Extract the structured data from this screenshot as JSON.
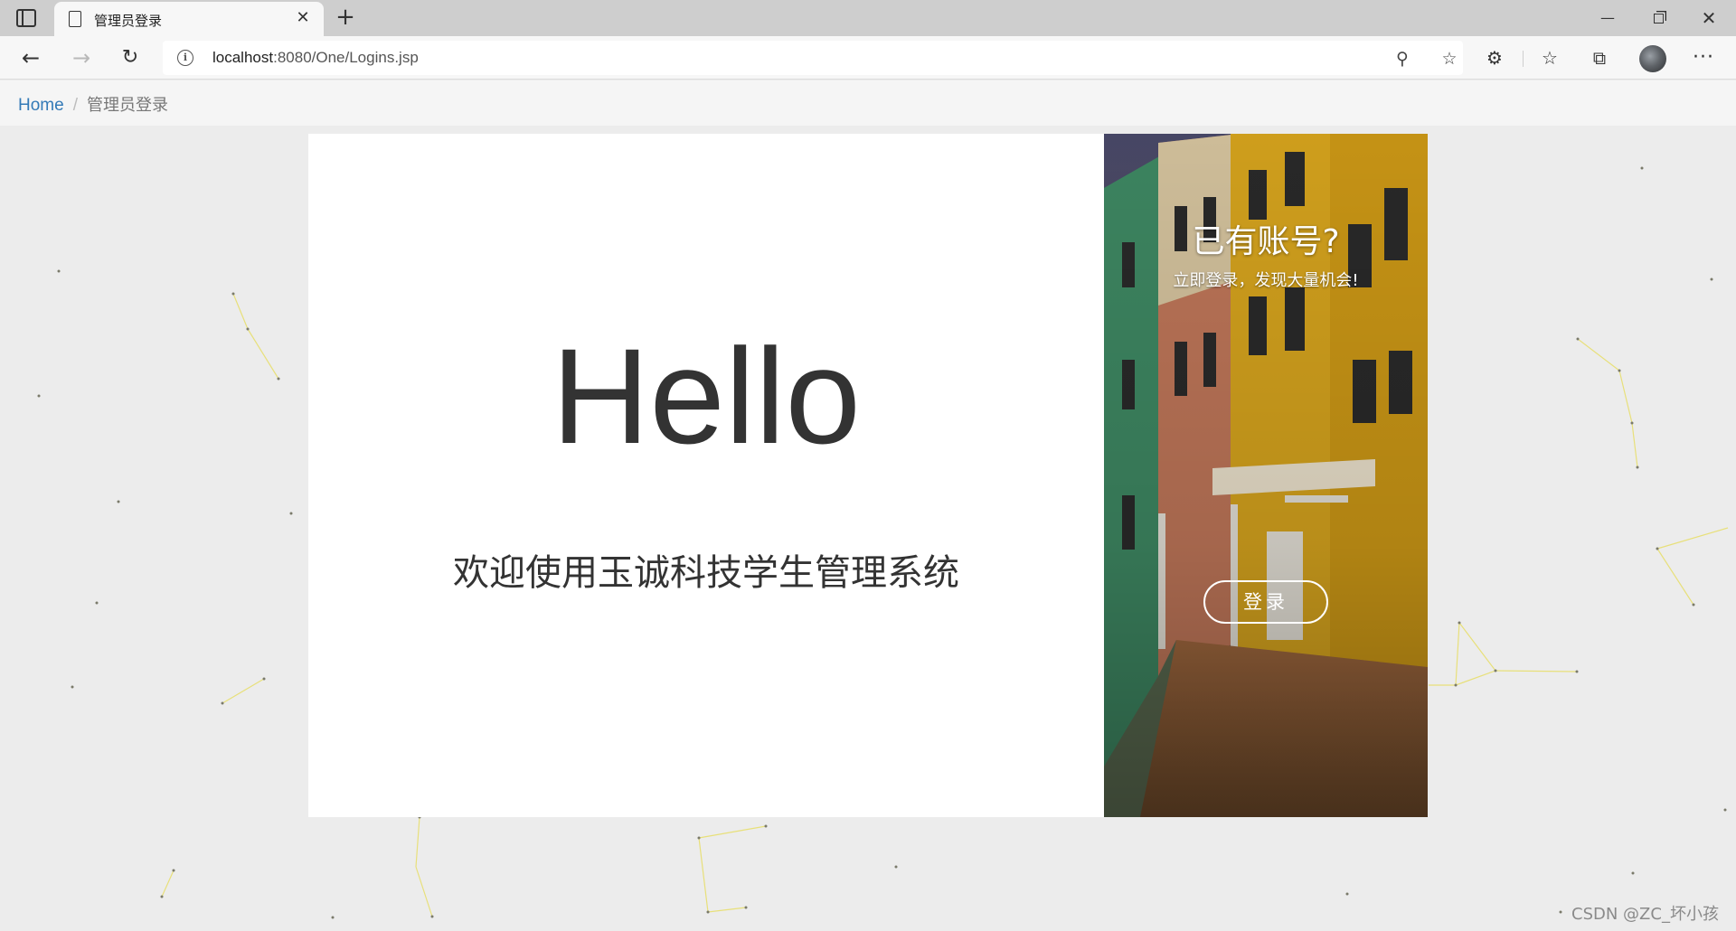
{
  "browser": {
    "tab_title": "管理员登录",
    "url_host": "localhost",
    "url_rest": ":8080/One/Logins.jsp"
  },
  "breadcrumb": {
    "home": "Home",
    "separator": "/",
    "current": "管理员登录"
  },
  "hero": {
    "greeting": "Hello",
    "welcome": "欢迎使用玉诚科技学生管理系统"
  },
  "side_panel": {
    "title": "已有账号?",
    "subtitle": "立即登录，发现大量机会!",
    "login_button": "登录"
  },
  "watermark": "CSDN @ZC_坏小孩",
  "colors": {
    "link": "#337ab7",
    "particle": "#e8e07a",
    "page_bg": "#ececec"
  }
}
